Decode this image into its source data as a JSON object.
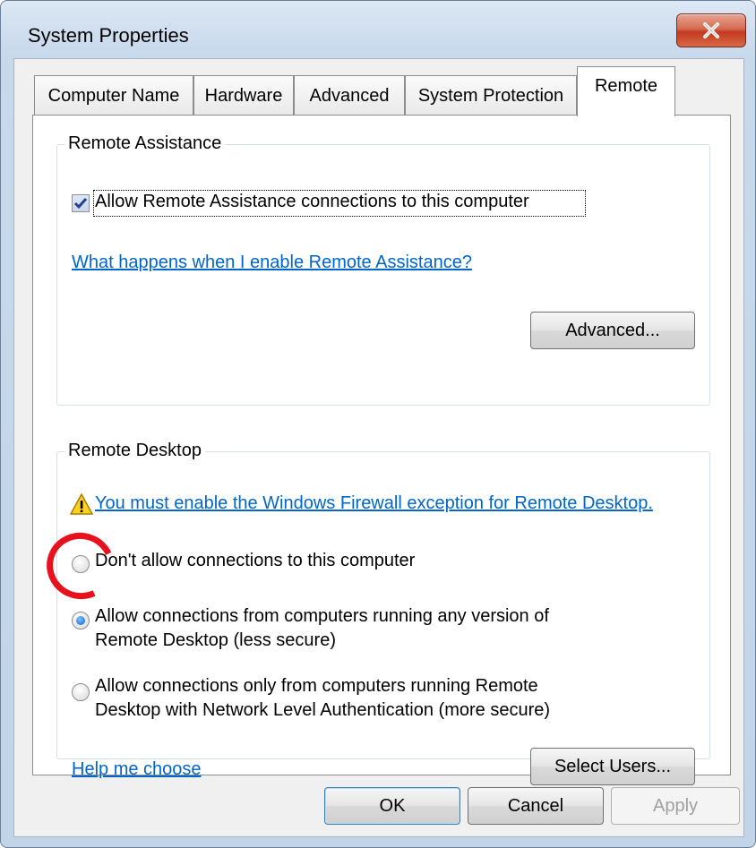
{
  "window": {
    "title": "System Properties"
  },
  "tabs": [
    {
      "label": "Computer Name",
      "active": false
    },
    {
      "label": "Hardware",
      "active": false
    },
    {
      "label": "Advanced",
      "active": false
    },
    {
      "label": "System Protection",
      "active": false
    },
    {
      "label": "Remote",
      "active": true
    }
  ],
  "remote_assistance": {
    "group_label": "Remote Assistance",
    "checkbox_label": "Allow Remote Assistance connections to this computer",
    "checkbox_checked": true,
    "help_link": "What happens when I enable Remote Assistance?",
    "advanced_button": "Advanced..."
  },
  "remote_desktop": {
    "group_label": "Remote Desktop",
    "warning_link": "You must enable the Windows Firewall exception for Remote Desktop.",
    "options": [
      {
        "line1": "Don't allow connections to this computer",
        "line2": "",
        "selected": false
      },
      {
        "line1": "Allow connections from computers running any version of",
        "line2": "Remote Desktop (less secure)",
        "selected": true
      },
      {
        "line1": "Allow connections only from computers running Remote",
        "line2": "Desktop with Network Level Authentication (more secure)",
        "selected": false
      }
    ],
    "help_link": "Help me choose",
    "select_users_button": "Select Users..."
  },
  "footer": {
    "ok": "OK",
    "cancel": "Cancel",
    "apply": "Apply"
  },
  "colors": {
    "annotation": "#e8121f",
    "link": "#0066cc"
  }
}
